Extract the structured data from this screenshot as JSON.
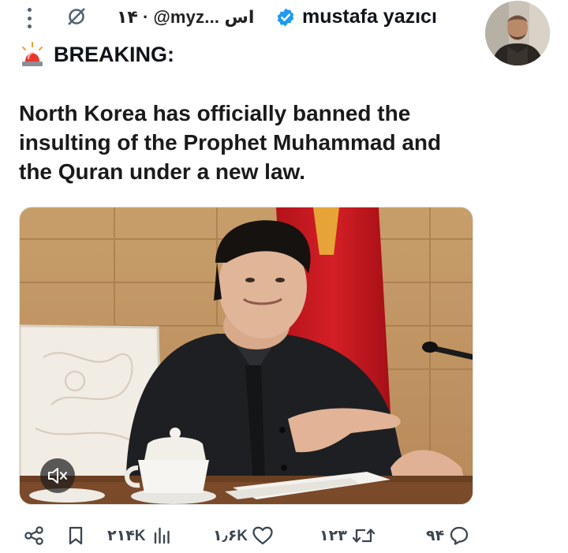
{
  "header": {
    "timestamp_handle": "۱۴ · @myz... اس",
    "display_name": "mustafa yazıcı",
    "icons": {
      "more": "more-vertical-icon",
      "grok": "grok-icon",
      "verified": "verified-badge-icon",
      "avatar": "avatar"
    },
    "colors": {
      "verified": "#1d9bf0"
    }
  },
  "tweet": {
    "breaking_label": "BREAKING:",
    "siren_icon": "police-light-icon",
    "text": "North Korea has officially banned the insulting of the Prophet Muhammad and the Quran under a new law."
  },
  "media": {
    "type": "video",
    "mute_icon": "speaker-muted-icon"
  },
  "actions": {
    "share_icon": "share-icon",
    "bookmark_icon": "bookmark-icon",
    "views_icon": "views-icon",
    "views_count": "۲۱۴K",
    "likes_icon": "heart-icon",
    "likes_count": "۱٫۶K",
    "reposts_icon": "repost-icon",
    "reposts_count": "۱۲۳",
    "replies_icon": "reply-icon",
    "replies_count": "۹۴"
  }
}
